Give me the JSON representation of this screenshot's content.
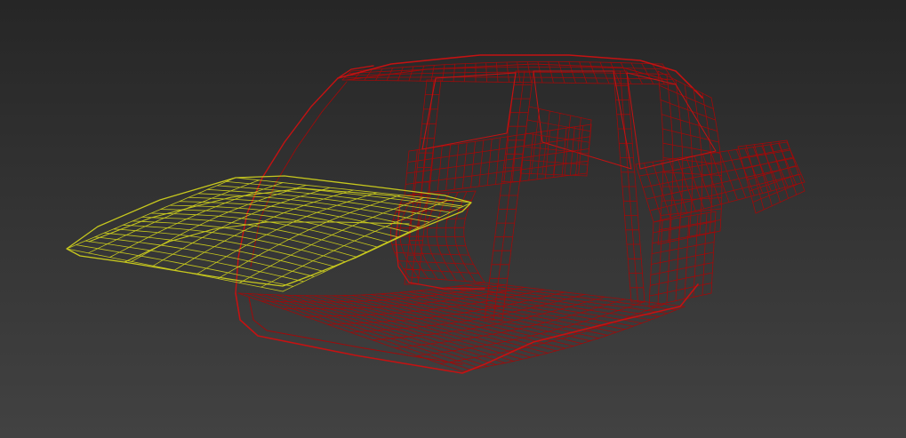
{
  "viewport": {
    "background_top": "#262626",
    "background_bottom": "#424242"
  },
  "car_body": {
    "wire_color": "#a00a0a",
    "highlight_color": "#c41212"
  },
  "hood_selected": {
    "wire_color": "#c7c81e"
  }
}
